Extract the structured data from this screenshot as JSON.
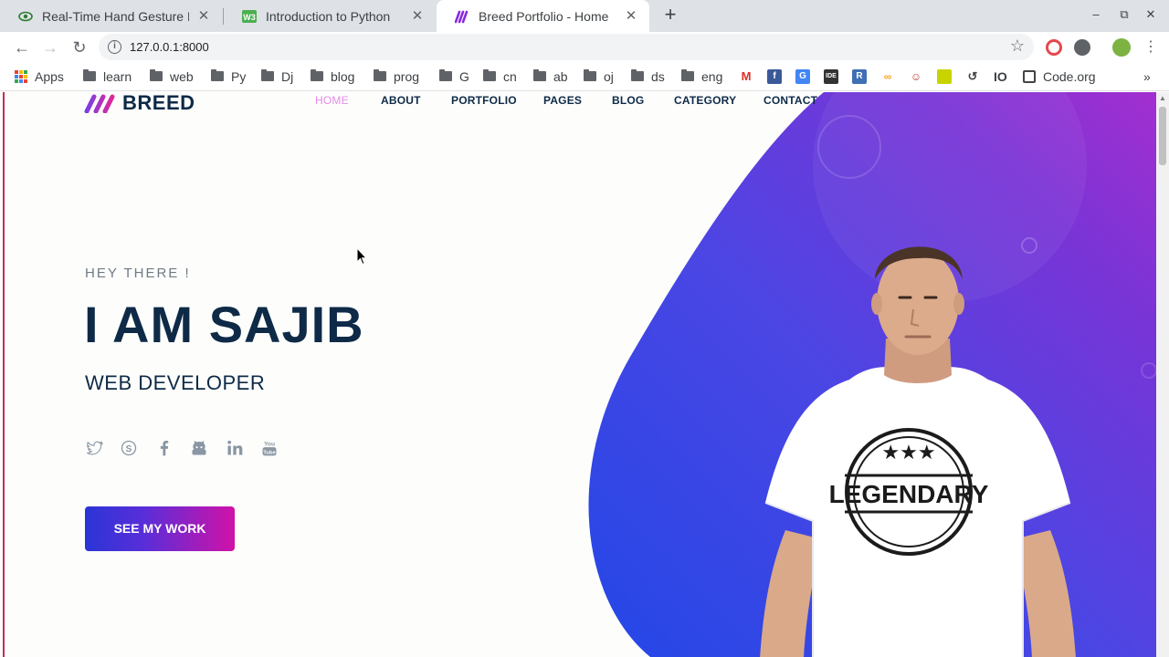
{
  "browser": {
    "tabs": [
      {
        "title": "Real-Time Hand Gesture R",
        "favicon": "eye-icon"
      },
      {
        "title": "Introduction to Python",
        "favicon": "w3-icon"
      },
      {
        "title": "Breed Portfolio - Home",
        "favicon": "breed-logo-icon",
        "active": true
      }
    ],
    "new_tab": "+",
    "close_glyph": "✕",
    "url": "127.0.0.1:8000",
    "window_controls": {
      "minimize": "‒",
      "restore": "⧉",
      "close": "✕"
    }
  },
  "bookmarks": {
    "apps_label": "Apps",
    "folders": [
      "learn",
      "web",
      "Py",
      "Dj",
      "blog",
      "prog",
      "G",
      "cn",
      "ab",
      "oj",
      "ds",
      "eng"
    ],
    "io_label": "IO",
    "codeorg_label": "Code.org",
    "more": "»"
  },
  "site": {
    "brand": "BREED",
    "nav": [
      "HOME",
      "ABOUT",
      "PORTFOLIO",
      "PAGES",
      "BLOG",
      "CATEGORY",
      "CONTACT"
    ],
    "active_nav": "HOME",
    "greeting": "HEY THERE !",
    "headline": "I AM SAJIB",
    "role": "WEB DEVELOPER",
    "social": [
      "twitter-icon",
      "skype-icon",
      "facebook-icon",
      "github-icon",
      "linkedin-icon",
      "youtube-icon"
    ],
    "cta": "SEE MY WORK",
    "tshirt_text": "LEGENDARY",
    "colors": {
      "navy": "#0e2a47",
      "accent_pink": "#e58be8",
      "gradient_blue": "#2a52e6",
      "gradient_purple": "#9b2fd0"
    }
  }
}
